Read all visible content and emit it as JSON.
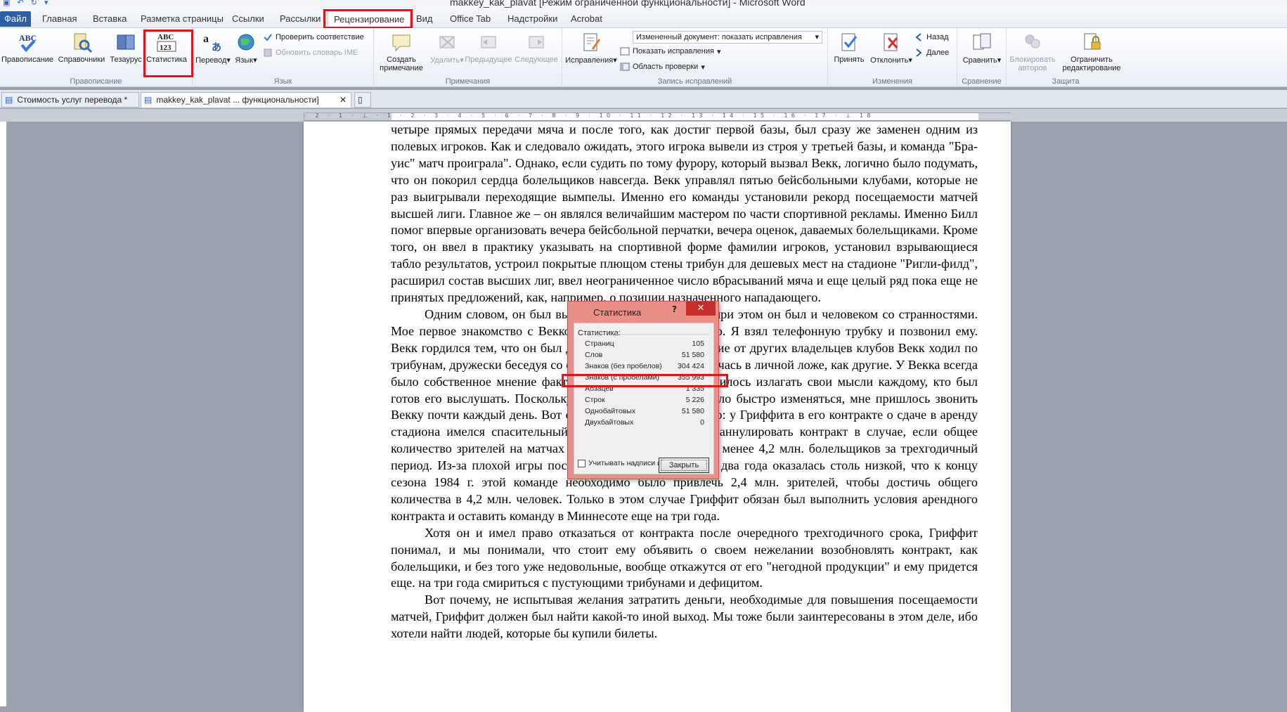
{
  "window": {
    "title": "makkey_kak_plavat [Режим ограниченной функциональности] - Microsoft Word"
  },
  "ribbon_tabs": [
    {
      "label": "Файл"
    },
    {
      "label": "Главная"
    },
    {
      "label": "Вставка"
    },
    {
      "label": "Разметка страницы"
    },
    {
      "label": "Ссылки"
    },
    {
      "label": "Рассылки"
    },
    {
      "label": "Рецензирование"
    },
    {
      "label": "Вид"
    },
    {
      "label": "Office Tab"
    },
    {
      "label": "Надстройки"
    },
    {
      "label": "Acrobat"
    }
  ],
  "groups": {
    "proofing": {
      "label": "Правописание",
      "spelling": "Правописание",
      "research": "Справочники",
      "thesaurus": "Тезаурус",
      "word_count": "Статистика"
    },
    "language": {
      "label": "Язык",
      "translate": "Перевод",
      "language": "Язык",
      "check_compat": "Проверить соответствие",
      "update_ime": "Обновить словарь IME"
    },
    "comments": {
      "label": "Примечания",
      "new": "Создать примечание",
      "delete": "Удалить",
      "previous": "Предыдущее",
      "next": "Следующее"
    },
    "tracking": {
      "label": "Запись исправлений",
      "track": "Исправления",
      "display_value": "Измененный документ: показать исправления",
      "show_markup": "Показать исправления",
      "reviewing_pane": "Область проверки"
    },
    "changes": {
      "label": "Изменения",
      "accept": "Принять",
      "reject": "Отклонить",
      "back": "Назад",
      "forward": "Далее"
    },
    "compare": {
      "label": "Сравнение",
      "compare": "Сравнить"
    },
    "protect": {
      "label": "Защита",
      "block_authors": "Блокировать авторов",
      "restrict": "Ограничить редактирование"
    }
  },
  "doc_tabs": [
    {
      "label": "Стоимость услуг перевода *"
    },
    {
      "label": "makkey_kak_plavat ... функциональности]"
    }
  ],
  "ruler_numbers": "· 2 · 1 · ⊥ · 1 · 2 · 3 · 4 · 5 · 6 · 7 · 8 · 9 · 10 · 11 · 12 · 13 · 14 · 15 · 16 · 17 · ⊥ 18",
  "document": {
    "paragraphs": [
      {
        "text": "четыре прямых передачи мяча и после того, как достиг первой базы, был сразу же заменен одним из полевых игроков. Как и следовало ожидать, этого игрока вывели из строя у третьей базы, и команда \"Бра- уис\" матч проиграла\". Однако, если судить по тому фурору, который вызвал Векк, логично было подумать, что он покорил сердца болельщиков навсегда. Векк управлял пятью бейсбольными клубами, которые не раз выигрывали переходящие вымпелы. Именно его команды установили рекорд посещаемости матчей высшей лиги. Главное же – он являлся величайшим мастером по части спортивной рекламы. Именно Билл помог впервые организовать вечера бейсбольной перчатки, вечера оценок, даваемых болельщиками. Кроме того, он ввел в практику указывать на спортивной форме фамилии игроков, установил взрывающиеся табло результатов, устроил покрытые плющом стены трибун для дешевых мест на стадионе \"Ригли-филд\", расширил состав высших лиг, ввел неограниченное число вбрасываний мяча и еще целый ряд пока еще не принятых предложений, как, например, о позиции назначенного нападающего.",
        "indent": false
      },
      {
        "text": "Одним словом, он был выдающимся человеком, но при этом он был и человеком со странностями. Мое первое знакомство с Векком произошло очень просто. Я взял телефонную трубку и позвонил ему. Векк гордился тем, что он был для всех доступен. В отличие от других владельцев клубов Векк ходил по трибунам, дружески беседуя со своими клиентами, а не прячась в личной ложе, как другие. У Векка всегда было собственное мнение фактически обо всем, ему нравилось излагать свои мысли каждому, кто был готов его выслушать. Поскольку положение в городе начало быстро изменяться, мне пришлось звонить Векку почти каждый день. Вот с чем было связано это дело: у Гриффита в его контракте о сдаче в аренду стадиона имелся спасительный пункт, позволявший ему аннулировать контракт в случае, если общее количество зрителей на матчах команды \"Туинс\" составит менее 4,2 млн. болельщиков за трехгодичный период. Из-за плохой игры посещаемость за предыдущие два года оказалась столь низкой, что к концу сезона 1984 г. этой команде необходимо было привлечь 2,4 млн. зрителей, чтобы достичь общего количества в 4,2 млн. человек. Только в этом случае Гриффит обязан был выполнить условия арендного контракта и оставить команду в Миннесоте еще на три года.",
        "indent": true
      },
      {
        "text": "Хотя он и имел право отказаться от контракта после очередного трехгодичного срока, Гриффит понимал, и мы понимали, что стоит ему объявить о своем нежелании возобновлять контракт, как болельщики, и без того уже недовольные, вообще откажутся от его \"негодной продукции\" и ему придется еще. на три года смириться с пустующими трибунами и дефицитом.",
        "indent": true
      },
      {
        "text": "Вот почему, не испытывая желания затратить деньги, необходимые для повышения посещаемости матчей, Гриффит должен был найти какой-то иной выход. Мы тоже были заинтересованы в этом деле, ибо хотели найти людей, которые бы купили билеты.",
        "indent": true
      }
    ]
  },
  "dialog": {
    "title": "Статистика",
    "help": "?",
    "close": "✕",
    "section_label": "Статистика:",
    "stats": [
      {
        "label": "Страниц",
        "value": "105"
      },
      {
        "label": "Слов",
        "value": "51 580"
      },
      {
        "label": "Знаков (без пробелов)",
        "value": "304 424"
      },
      {
        "label": "Знаков (с пробелами)",
        "value": "355 993"
      },
      {
        "label": "Абзацев",
        "value": "1 335"
      },
      {
        "label": "Строк",
        "value": "5 226"
      },
      {
        "label": "Однобайтовых",
        "value": "51 580"
      },
      {
        "label": "Двухбайтовых",
        "value": "0"
      }
    ],
    "checkbox_label": "Учитывать надписи и сноски",
    "close_button": "Закрыть"
  },
  "colors": {
    "highlight": "#e0141c",
    "file_tab": "#2a5ea8",
    "dialog_frame": "#e98f86"
  }
}
